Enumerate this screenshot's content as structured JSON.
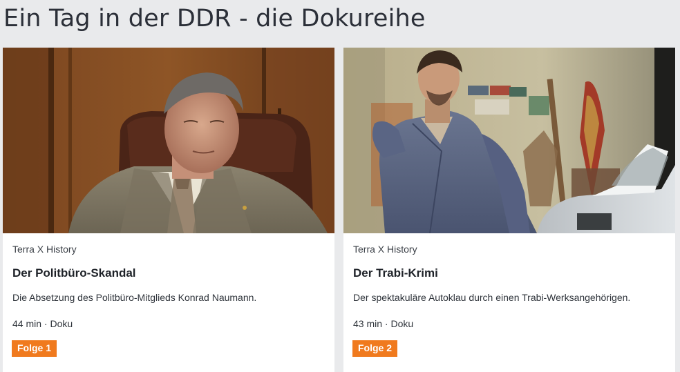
{
  "page": {
    "title": "Ein Tag in der DDR - die Dokureihe"
  },
  "cards": [
    {
      "image_alt": "Mann im grauen Anzug sitzt in einem braunen Ledersessel in holzvertäfeltem Büro",
      "brand": "Terra X History",
      "title": "Der Politbüro-Skandal",
      "description": "Die Absetzung des Politbüro-Mitglieds Konrad Naumann.",
      "duration": "44 min",
      "separator": "·",
      "genre": "Doku",
      "episode": "Folge 1"
    },
    {
      "image_alt": "Mann in blauer Arbeitsjacke steht in einer Garage neben einem Auto",
      "brand": "Terra X History",
      "title": "Der Trabi-Krimi",
      "description": "Der spektakuläre Autoklau durch einen Trabi-Werksangehörigen.",
      "duration": "43 min",
      "separator": "·",
      "genre": "Doku",
      "episode": "Folge 2"
    }
  ],
  "colors": {
    "page_background": "#e9eaec",
    "card_background": "#ffffff",
    "badge_background": "#f07a1e",
    "badge_text": "#ffffff",
    "text": "#2b2f38"
  }
}
